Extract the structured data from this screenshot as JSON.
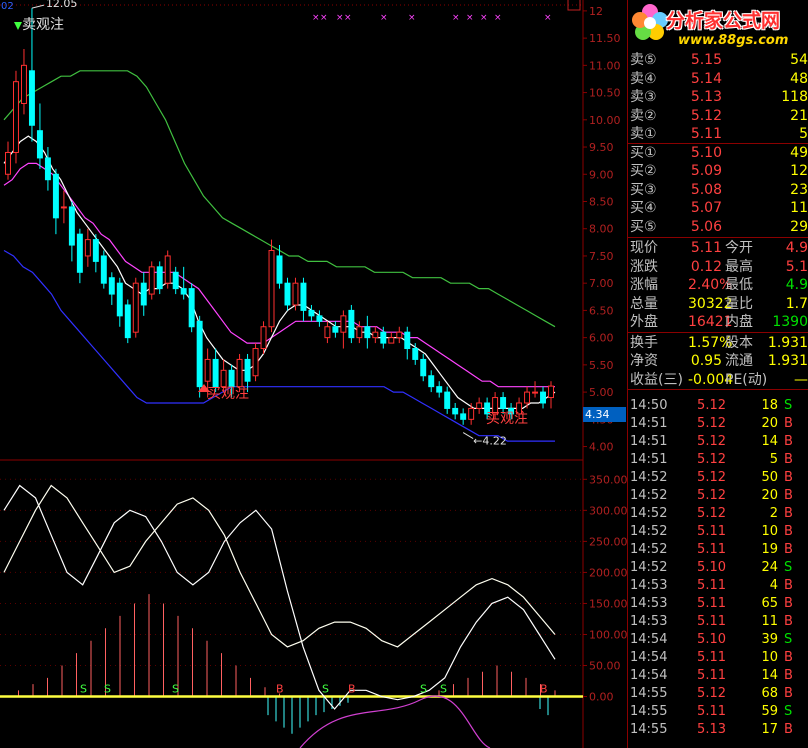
{
  "chart": {
    "top_left_code": "02",
    "corner_box": "回",
    "signal_labels": {
      "sell_top": "卖观注",
      "buy_1": "买观注",
      "buy_2": "买观注"
    },
    "annotations": {
      "high": "12.05",
      "low": "4.22",
      "last_tag": "4.34"
    },
    "colors": {
      "up": "#ff3030",
      "down": "#00ffff",
      "ma_white": "#ffffff",
      "ma_magenta": "#ff44ff",
      "upper_band": "#40c040",
      "lower_band": "#3030ff"
    }
  },
  "chart_data": [
    {
      "type": "candlestick",
      "y_ticks": [
        "12",
        "11.50",
        "11.00",
        "10.50",
        "10.00",
        "9.50",
        "9.00",
        "8.50",
        "8.00",
        "7.50",
        "7.00",
        "6.50",
        "6.00",
        "5.50",
        "5.00",
        "4.50",
        "4.00"
      ],
      "ylim": [
        3.9,
        12.2
      ],
      "candles": [
        [
          9.0,
          9.4,
          8.9,
          9.6
        ],
        [
          9.4,
          10.7,
          9.2,
          10.9
        ],
        [
          10.3,
          11.0,
          10.1,
          11.3
        ],
        [
          10.9,
          9.9,
          9.6,
          12.05
        ],
        [
          9.8,
          9.3,
          9.1,
          10.3
        ],
        [
          9.3,
          8.9,
          8.7,
          9.5
        ],
        [
          9.0,
          8.2,
          7.9,
          9.1
        ],
        [
          8.4,
          8.4,
          8.1,
          8.7
        ],
        [
          8.4,
          7.7,
          7.4,
          8.5
        ],
        [
          7.9,
          7.2,
          7.0,
          8.0
        ],
        [
          7.5,
          7.8,
          7.3,
          8.0
        ],
        [
          7.8,
          7.4,
          7.2,
          7.9
        ],
        [
          7.5,
          7.0,
          6.9,
          7.6
        ],
        [
          7.1,
          6.8,
          6.6,
          7.2
        ],
        [
          7.0,
          6.4,
          6.2,
          7.1
        ],
        [
          6.6,
          6.0,
          5.9,
          6.7
        ],
        [
          6.1,
          7.0,
          6.0,
          7.1
        ],
        [
          7.0,
          6.6,
          6.4,
          7.2
        ],
        [
          6.8,
          7.3,
          6.7,
          7.4
        ],
        [
          7.3,
          6.9,
          6.8,
          7.4
        ],
        [
          7.0,
          7.5,
          6.9,
          7.6
        ],
        [
          7.2,
          6.9,
          6.8,
          7.3
        ],
        [
          6.9,
          6.8,
          6.7,
          7.3
        ],
        [
          6.9,
          6.2,
          6.1,
          7.0
        ],
        [
          6.3,
          5.1,
          4.9,
          6.4
        ],
        [
          5.2,
          5.6,
          4.9,
          5.8
        ],
        [
          5.6,
          5.1,
          5.0,
          5.8
        ],
        [
          5.1,
          5.4,
          5.0,
          5.6
        ],
        [
          5.4,
          5.1,
          4.9,
          5.5
        ],
        [
          5.1,
          5.6,
          5.0,
          5.7
        ],
        [
          5.6,
          5.2,
          5.0,
          5.7
        ],
        [
          5.3,
          5.8,
          5.2,
          5.9
        ],
        [
          5.8,
          6.2,
          5.7,
          6.3
        ],
        [
          6.2,
          7.6,
          6.1,
          7.8
        ],
        [
          7.5,
          7.0,
          6.9,
          7.7
        ],
        [
          7.0,
          6.6,
          6.5,
          7.1
        ],
        [
          6.6,
          7.0,
          6.5,
          7.1
        ],
        [
          7.0,
          6.5,
          6.3,
          7.1
        ],
        [
          6.5,
          6.4,
          6.3,
          6.6
        ],
        [
          6.4,
          6.3,
          6.2,
          6.5
        ],
        [
          6.0,
          6.2,
          5.9,
          6.3
        ],
        [
          6.2,
          6.1,
          6.0,
          6.3
        ],
        [
          6.1,
          6.4,
          5.8,
          6.5
        ],
        [
          6.5,
          6.0,
          5.9,
          6.6
        ],
        [
          6.0,
          6.2,
          5.9,
          6.3
        ],
        [
          6.2,
          6.0,
          5.8,
          6.4
        ],
        [
          6.0,
          6.1,
          5.9,
          6.2
        ],
        [
          6.1,
          5.9,
          5.8,
          6.2
        ],
        [
          5.9,
          6.0,
          5.9,
          6.1
        ],
        [
          6.0,
          6.1,
          5.9,
          6.2
        ],
        [
          6.1,
          5.8,
          5.6,
          6.2
        ],
        [
          5.8,
          5.6,
          5.5,
          5.9
        ],
        [
          5.6,
          5.3,
          5.2,
          5.7
        ],
        [
          5.3,
          5.1,
          5.0,
          5.4
        ],
        [
          5.1,
          5.0,
          4.9,
          5.2
        ],
        [
          5.0,
          4.7,
          4.6,
          5.1
        ],
        [
          4.7,
          4.6,
          4.5,
          4.8
        ],
        [
          4.6,
          4.5,
          4.4,
          4.7
        ],
        [
          4.5,
          4.7,
          4.4,
          4.8
        ],
        [
          4.7,
          4.8,
          4.6,
          4.9
        ],
        [
          4.8,
          4.6,
          4.5,
          4.9
        ],
        [
          4.6,
          4.9,
          4.5,
          5.0
        ],
        [
          4.9,
          4.7,
          4.6,
          5.0
        ],
        [
          4.7,
          4.6,
          4.5,
          4.8
        ],
        [
          4.6,
          4.8,
          4.5,
          4.9
        ],
        [
          4.8,
          5.0,
          4.7,
          5.1
        ],
        [
          5.0,
          5.0,
          4.9,
          5.2
        ],
        [
          5.0,
          4.8,
          4.7,
          5.1
        ],
        [
          4.9,
          5.11,
          4.7,
          5.2
        ]
      ],
      "ma_white": [
        9.2,
        9.4,
        9.6,
        9.7,
        9.6,
        9.4,
        9.1,
        8.9,
        8.6,
        8.3,
        8.1,
        7.9,
        7.7,
        7.5,
        7.3,
        7.0,
        6.9,
        6.8,
        6.9,
        6.9,
        7.0,
        7.0,
        6.9,
        6.7,
        6.3,
        6.0,
        5.8,
        5.6,
        5.5,
        5.4,
        5.4,
        5.5,
        5.7,
        6.0,
        6.3,
        6.5,
        6.6,
        6.6,
        6.5,
        6.4,
        6.3,
        6.2,
        6.2,
        6.2,
        6.1,
        6.1,
        6.0,
        6.0,
        6.0,
        6.0,
        5.9,
        5.8,
        5.7,
        5.5,
        5.3,
        5.1,
        4.9,
        4.8,
        4.7,
        4.7,
        4.7,
        4.7,
        4.7,
        4.7,
        4.7,
        4.8,
        4.8,
        4.9,
        5.0
      ],
      "ma_magenta": [
        8.8,
        8.9,
        9.1,
        9.2,
        9.2,
        9.1,
        9.0,
        8.8,
        8.6,
        8.4,
        8.2,
        8.1,
        7.9,
        7.8,
        7.6,
        7.4,
        7.3,
        7.2,
        7.2,
        7.2,
        7.2,
        7.2,
        7.1,
        7.0,
        6.9,
        6.7,
        6.5,
        6.3,
        6.1,
        6.0,
        5.9,
        5.9,
        5.9,
        6.0,
        6.1,
        6.2,
        6.3,
        6.3,
        6.3,
        6.3,
        6.3,
        6.3,
        6.3,
        6.3,
        6.2,
        6.2,
        6.2,
        6.1,
        6.1,
        6.1,
        6.0,
        6.0,
        5.9,
        5.8,
        5.7,
        5.6,
        5.5,
        5.4,
        5.3,
        5.2,
        5.2,
        5.1,
        5.1,
        5.1,
        5.1,
        5.1,
        5.1,
        5.1,
        5.1
      ],
      "upper_band": [
        10.0,
        10.2,
        10.4,
        10.5,
        10.6,
        10.7,
        10.8,
        10.8,
        10.9,
        10.9,
        10.9,
        10.9,
        10.9,
        10.9,
        10.8,
        10.6,
        10.3,
        10.0,
        9.6,
        9.2,
        8.9,
        8.6,
        8.4,
        8.2,
        8.1,
        8.0,
        7.9,
        7.8,
        7.7,
        7.6,
        7.5,
        7.5,
        7.4,
        7.4,
        7.4,
        7.3,
        7.3,
        7.3,
        7.3,
        7.2,
        7.2,
        7.2,
        7.2,
        7.1,
        7.1,
        7.1,
        7.1,
        7.0,
        7.0,
        7.0,
        6.9,
        6.9,
        6.8,
        6.7,
        6.6,
        6.5,
        6.4,
        6.3,
        6.2
      ],
      "lower_band": [
        7.6,
        7.5,
        7.3,
        7.2,
        7.0,
        6.8,
        6.5,
        6.3,
        6.1,
        5.9,
        5.7,
        5.5,
        5.3,
        5.1,
        4.9,
        4.8,
        4.8,
        4.8,
        4.8,
        4.8,
        4.8,
        4.8,
        4.9,
        5.0,
        5.1,
        5.1,
        5.1,
        5.1,
        5.1,
        5.1,
        5.1,
        5.1,
        5.1,
        5.1,
        5.1,
        5.1,
        5.1,
        5.1,
        5.1,
        5.1,
        5.1,
        5.0,
        5.0,
        4.9,
        4.8,
        4.7,
        4.6,
        4.5,
        4.4,
        4.3,
        4.2,
        4.2,
        4.2,
        4.1,
        4.1,
        4.1,
        4.1,
        4.1,
        4.1
      ]
    },
    {
      "type": "line",
      "y_ticks": [
        "350.00",
        "300.00",
        "250.00",
        "200.00",
        "150.00",
        "100.00",
        "50.00",
        "0.00"
      ],
      "ylim": [
        -70,
        365
      ],
      "line_white": [
        300,
        340,
        320,
        260,
        200,
        180,
        230,
        280,
        300,
        290,
        250,
        200,
        180,
        200,
        250,
        280,
        300,
        270,
        170,
        80,
        10,
        -20,
        10,
        10,
        0,
        -5,
        0,
        10,
        30,
        80,
        120,
        150,
        160,
        140,
        100,
        60
      ],
      "line_yellow": [
        200,
        250,
        300,
        340,
        320,
        280,
        240,
        200,
        210,
        250,
        280,
        310,
        320,
        300,
        260,
        200,
        150,
        100,
        80,
        90,
        110,
        120,
        120,
        110,
        90,
        80,
        100,
        120,
        140,
        160,
        180,
        190,
        180,
        160,
        130,
        100
      ],
      "histogram": [
        0,
        10,
        20,
        30,
        50,
        70,
        90,
        110,
        130,
        150,
        165,
        150,
        130,
        110,
        90,
        70,
        50,
        30,
        15,
        5,
        0,
        0,
        0,
        0,
        0,
        0,
        0,
        0,
        0,
        0,
        10,
        20,
        30,
        40,
        50,
        40,
        30,
        20,
        10
      ]
    }
  ],
  "quote": {
    "logo_brand": "分析家公式网",
    "logo_url": "www.88gs.com",
    "order_book": [
      {
        "label": "卖⑤",
        "price": "5.15",
        "vol": "54"
      },
      {
        "label": "卖④",
        "price": "5.14",
        "vol": "48"
      },
      {
        "label": "卖③",
        "price": "5.13",
        "vol": "118"
      },
      {
        "label": "卖②",
        "price": "5.12",
        "vol": "21"
      },
      {
        "label": "卖①",
        "price": "5.11",
        "vol": "5"
      },
      {
        "label": "买①",
        "price": "5.10",
        "vol": "49"
      },
      {
        "label": "买②",
        "price": "5.09",
        "vol": "12"
      },
      {
        "label": "买③",
        "price": "5.08",
        "vol": "23"
      },
      {
        "label": "买④",
        "price": "5.07",
        "vol": "11"
      },
      {
        "label": "买⑤",
        "price": "5.06",
        "vol": "29"
      }
    ],
    "stats": [
      {
        "l1": "现价",
        "v1": "5.11",
        "c1": "red",
        "l2": "今开",
        "v2": "4.9",
        "c2": "red"
      },
      {
        "l1": "涨跌",
        "v1": "0.12",
        "c1": "red",
        "l2": "最高",
        "v2": "5.1",
        "c2": "red"
      },
      {
        "l1": "涨幅",
        "v1": "2.40%",
        "c1": "red",
        "l2": "最低",
        "v2": "4.9",
        "c2": "green"
      },
      {
        "l1": "总量",
        "v1": "30322",
        "c1": "yel",
        "l2": "量比",
        "v2": "1.7",
        "c2": "yel"
      },
      {
        "l1": "外盘",
        "v1": "16421",
        "c1": "red",
        "l2": "内盘",
        "v2": "1390",
        "c2": "green"
      }
    ],
    "stats2": [
      {
        "l1": "换手",
        "v1": "1.57%",
        "l2": "股本",
        "v2": "1.931"
      },
      {
        "l1": "净资",
        "v1": "0.95",
        "l2": "流通",
        "v2": "1.931"
      },
      {
        "l1": "收益(三)",
        "v1": "-0.004",
        "l2": "PE(动)",
        "v2": "—"
      }
    ],
    "ticks": [
      {
        "t": "14:50",
        "p": "5.12",
        "q": "18",
        "d": "S"
      },
      {
        "t": "14:51",
        "p": "5.12",
        "q": "20",
        "d": "B"
      },
      {
        "t": "14:51",
        "p": "5.12",
        "q": "14",
        "d": "B"
      },
      {
        "t": "14:51",
        "p": "5.12",
        "q": "5",
        "d": "B"
      },
      {
        "t": "14:52",
        "p": "5.12",
        "q": "50",
        "d": "B"
      },
      {
        "t": "14:52",
        "p": "5.12",
        "q": "20",
        "d": "B"
      },
      {
        "t": "14:52",
        "p": "5.12",
        "q": "2",
        "d": "B"
      },
      {
        "t": "14:52",
        "p": "5.11",
        "q": "10",
        "d": "B"
      },
      {
        "t": "14:52",
        "p": "5.11",
        "q": "19",
        "d": "B"
      },
      {
        "t": "14:52",
        "p": "5.10",
        "q": "24",
        "d": "S"
      },
      {
        "t": "14:53",
        "p": "5.11",
        "q": "4",
        "d": "B"
      },
      {
        "t": "14:53",
        "p": "5.11",
        "q": "65",
        "d": "B"
      },
      {
        "t": "14:53",
        "p": "5.11",
        "q": "11",
        "d": "B"
      },
      {
        "t": "14:54",
        "p": "5.10",
        "q": "39",
        "d": "S"
      },
      {
        "t": "14:54",
        "p": "5.11",
        "q": "10",
        "d": "B"
      },
      {
        "t": "14:54",
        "p": "5.11",
        "q": "14",
        "d": "B"
      },
      {
        "t": "14:55",
        "p": "5.12",
        "q": "68",
        "d": "B"
      },
      {
        "t": "14:55",
        "p": "5.11",
        "q": "59",
        "d": "S"
      },
      {
        "t": "14:55",
        "p": "5.13",
        "q": "17",
        "d": "B"
      }
    ]
  }
}
